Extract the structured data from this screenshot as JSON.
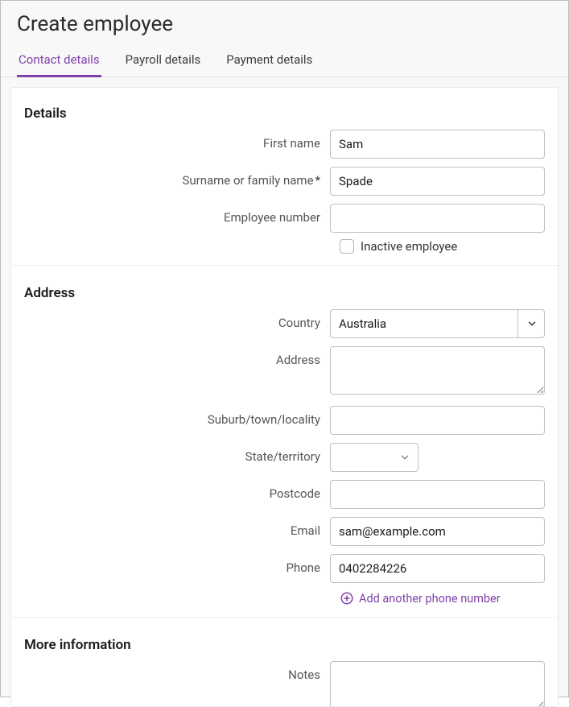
{
  "pageTitle": "Create employee",
  "tabs": {
    "contact": "Contact details",
    "payroll": "Payroll details",
    "payment": "Payment details"
  },
  "sections": {
    "details": "Details",
    "address": "Address",
    "moreInfo": "More information"
  },
  "labels": {
    "firstName": "First name",
    "surname": "Surname or family name",
    "requiredMark": "*",
    "employeeNumber": "Employee number",
    "inactive": "Inactive employee",
    "country": "Country",
    "address": "Address",
    "suburb": "Suburb/town/locality",
    "state": "State/territory",
    "postcode": "Postcode",
    "email": "Email",
    "phone": "Phone",
    "addPhone": "Add another phone number",
    "notes": "Notes"
  },
  "values": {
    "firstName": "Sam",
    "surname": "Spade",
    "employeeNumber": "",
    "inactiveChecked": false,
    "country": "Australia",
    "address": "",
    "suburb": "",
    "state": "",
    "postcode": "",
    "email": "sam@example.com",
    "phone": "0402284226",
    "notes": ""
  }
}
